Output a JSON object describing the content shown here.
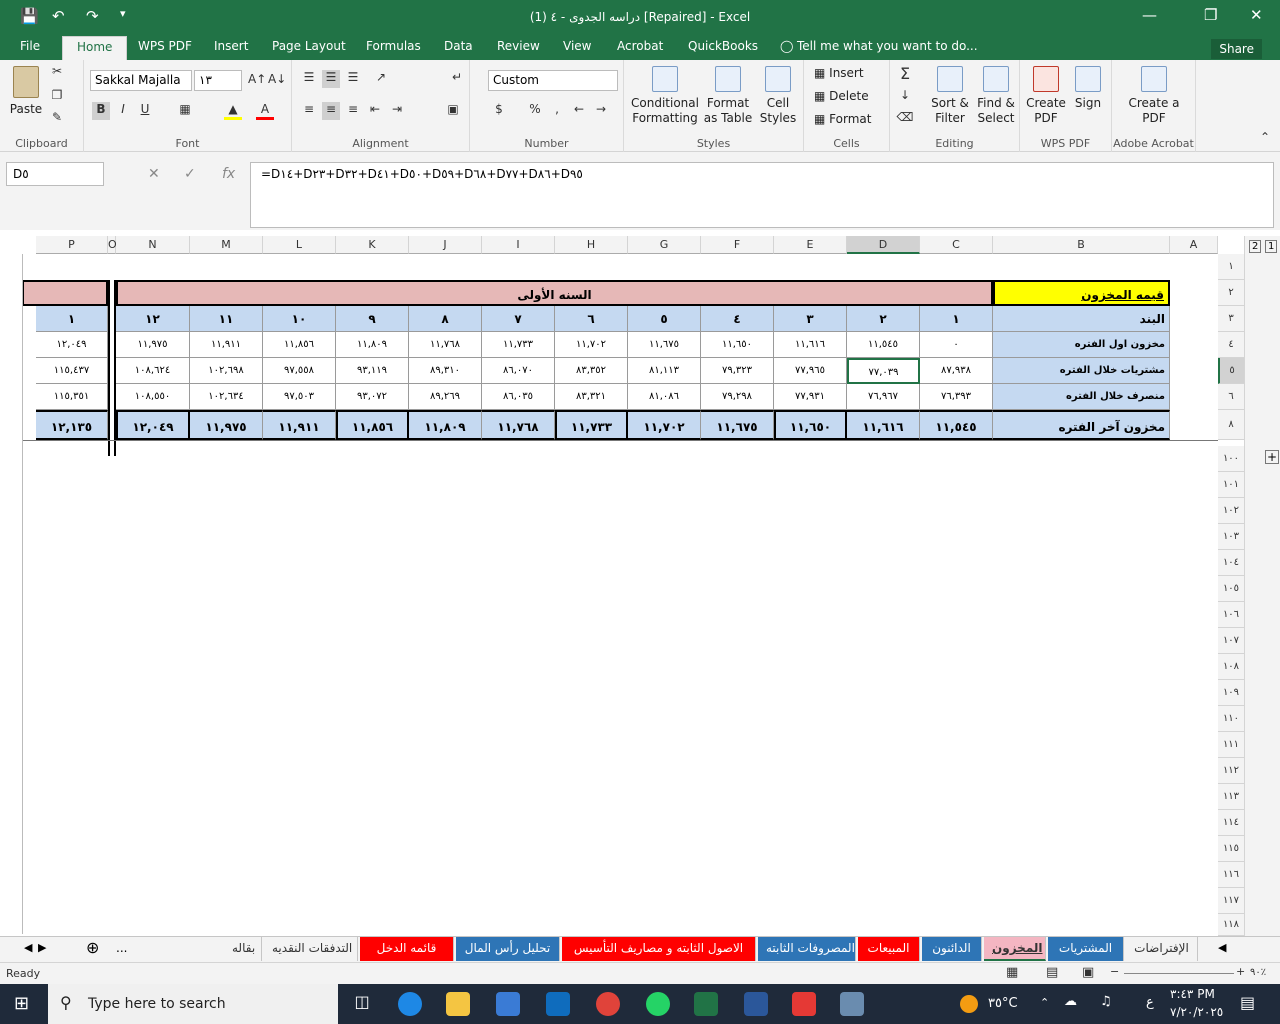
{
  "title": "دراسه الجدوى - ٤ (1) [Repaired] - Excel",
  "menu": {
    "file": "File",
    "tabs": [
      "Home",
      "WPS PDF",
      "Insert",
      "Page Layout",
      "Formulas",
      "Data",
      "Review",
      "View",
      "Acrobat",
      "QuickBooks"
    ],
    "tellme": "Tell me what you want to do...",
    "share": "Share"
  },
  "ribbon": {
    "clipboard": {
      "paste": "Paste",
      "label": "Clipboard"
    },
    "font": {
      "name": "Sakkal Majalla",
      "size": "١٣",
      "bold": "B",
      "italic": "I",
      "underline": "U",
      "label": "Font"
    },
    "alignment": {
      "label": "Alignment"
    },
    "number": {
      "format": "Custom",
      "label": "Number",
      "currency": "$",
      "percent": "%"
    },
    "styles": {
      "cond": "Conditional Formatting",
      "table": "Format as Table",
      "cell": "Cell Styles",
      "label": "Styles"
    },
    "cells": {
      "insert": "Insert",
      "delete": "Delete",
      "format": "Format",
      "label": "Cells"
    },
    "editing": {
      "sort": "Sort & Filter",
      "find": "Find & Select",
      "label": "Editing"
    },
    "wps": {
      "create": "Create PDF",
      "sign": "Sign",
      "label": "WPS PDF"
    },
    "acrobat": {
      "create": "Create a PDF",
      "label": "Adobe Acrobat"
    }
  },
  "formula": {
    "namebox": "D٥",
    "content": "=D١٤+D٢٣+D٣٢+D٤١+D٥٠+D٥٩+D٦٨+D٧٧+D٨٦+D٩٥"
  },
  "columns": [
    "P",
    "O",
    "N",
    "M",
    "L",
    "K",
    "J",
    "I",
    "H",
    "G",
    "F",
    "E",
    "D",
    "C",
    "B",
    "A"
  ],
  "rows": [
    "١",
    "٢",
    "٣",
    "٤",
    "٥",
    "٦",
    "٨",
    "١٠٠",
    "١٠١",
    "١٠٢",
    "١٠٣",
    "١٠٤",
    "١٠٥",
    "١٠٦",
    "١٠٧",
    "١٠٨",
    "١٠٩",
    "١١٠",
    "١١١",
    "١١٢",
    "١١٣",
    "١١٤",
    "١١٥",
    "١١٦",
    "١١٧",
    "١١٨"
  ],
  "sheet": {
    "header_label": "قيمه المخزون",
    "year_label": "السنه الأولى",
    "item_label": "البند",
    "period_numbers": [
      "١",
      "٢",
      "٣",
      "٤",
      "٥",
      "٦",
      "٧",
      "٨",
      "٩",
      "١٠",
      "١١",
      "١٢"
    ],
    "p_period": "١",
    "rows": [
      {
        "label": "مخزون اول الفتره",
        "values": [
          "٠",
          "١١,٥٤٥",
          "١١,٦١٦",
          "١١,٦٥٠",
          "١١,٦٧٥",
          "١١,٧٠٢",
          "١١,٧٣٣",
          "١١,٧٦٨",
          "١١,٨٠٩",
          "١١,٨٥٦",
          "١١,٩١١",
          "١١,٩٧٥"
        ],
        "p": "١٢,٠٤٩"
      },
      {
        "label": "مشتريات خلال الفتره",
        "values": [
          "٨٧,٩٣٨",
          "٧٧,٠٣٩",
          "٧٧,٩٦٥",
          "٧٩,٣٢٣",
          "٨١,١١٣",
          "٨٣,٣٥٢",
          "٨٦,٠٧٠",
          "٨٩,٣١٠",
          "٩٣,١١٩",
          "٩٧,٥٥٨",
          "١٠٢,٦٩٨",
          "١٠٨,٦٢٤"
        ],
        "p": "١١٥,٤٣٧"
      },
      {
        "label": "منصرف خلال الفتره",
        "values": [
          "٧٦,٣٩٣",
          "٧٦,٩٦٧",
          "٧٧,٩٣١",
          "٧٩,٢٩٨",
          "٨١,٠٨٦",
          "٨٣,٣٢١",
          "٨٦,٠٣٥",
          "٨٩,٢٦٩",
          "٩٣,٠٧٢",
          "٩٧,٥٠٣",
          "١٠٢,٦٣٤",
          "١٠٨,٥٥٠"
        ],
        "p": "١١٥,٣٥١"
      }
    ],
    "total": {
      "label": "مخزون آخر الفتره",
      "values": [
        "١١,٥٤٥",
        "١١,٦١٦",
        "١١,٦٥٠",
        "١١,٦٧٥",
        "١١,٧٠٢",
        "١١,٧٣٣",
        "١١,٧٦٨",
        "١١,٨٠٩",
        "١١,٨٥٦",
        "١١,٩١١",
        "١١,٩٧٥",
        "١٢,٠٤٩"
      ],
      "p": "١٢,١٣٥"
    }
  },
  "sheet_tabs": [
    {
      "name": "الإفتراضات",
      "color": "#f3f3f3",
      "text": "#333"
    },
    {
      "name": "المشتريات",
      "color": "#2e75b6",
      "text": "#fff"
    },
    {
      "name": "المخزون",
      "color": "#f4b6c2",
      "text": "#333",
      "active": true
    },
    {
      "name": "الدائنون",
      "color": "#2e75b6",
      "text": "#fff"
    },
    {
      "name": "المبيعات",
      "color": "#ff0000",
      "text": "#fff"
    },
    {
      "name": "المصروفات الثابته",
      "color": "#2e75b6",
      "text": "#fff"
    },
    {
      "name": "الاصول الثابته و مصاريف التأسيس",
      "color": "#ff0000",
      "text": "#fff"
    },
    {
      "name": "تحليل رأس المال",
      "color": "#2e75b6",
      "text": "#fff"
    },
    {
      "name": "قائمه الدخل",
      "color": "#ff0000",
      "text": "#fff"
    },
    {
      "name": "التدفقات النقديه",
      "color": "#f3f3f3",
      "text": "#333"
    },
    {
      "name": "بقاله",
      "color": "#f3f3f3",
      "text": "#333"
    }
  ],
  "tab_more": "...",
  "status": {
    "ready": "Ready",
    "zoom": "٩٠٪"
  },
  "taskbar": {
    "search": "Type here to search",
    "temp": "٣٥°C",
    "lang": "ع",
    "time": "٣:٤٣ PM",
    "date": "٧/٢٠/٢٠٢٥",
    "colors": {
      "taskbar": "#1f2a3a",
      "excel": "#217346"
    }
  }
}
